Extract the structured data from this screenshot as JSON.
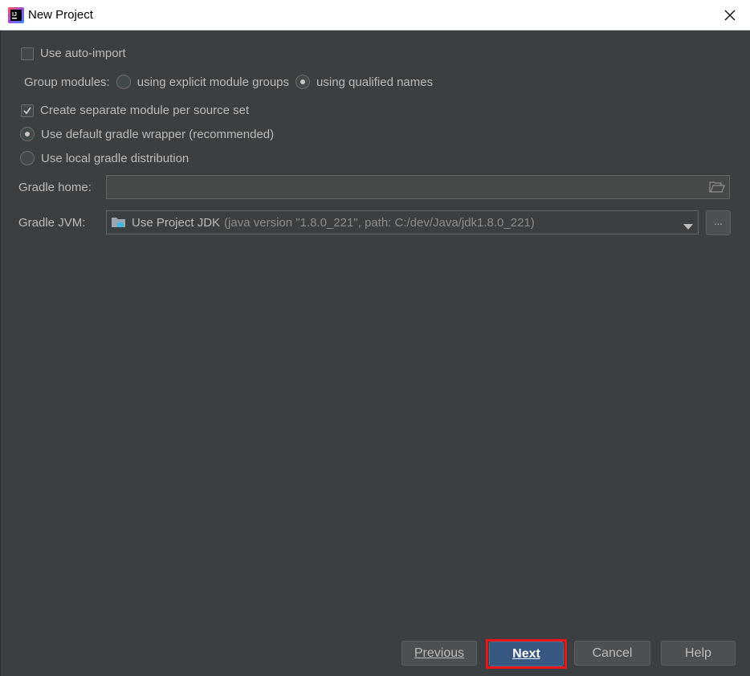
{
  "window": {
    "title": "New Project",
    "app_icon": "intellij-idea-icon",
    "close_icon": "close-icon"
  },
  "options": {
    "auto_import": {
      "label": "Use auto-import",
      "checked": false
    },
    "group_modules": {
      "label": "Group modules:",
      "explicit": {
        "label": "using explicit module groups",
        "selected": false
      },
      "qualified": {
        "label": "using qualified names",
        "selected": true
      }
    },
    "separate_module": {
      "label": "Create separate module per source set",
      "checked": true
    },
    "default_wrapper": {
      "label": "Use default gradle wrapper (recommended)",
      "selected": true
    },
    "local_distribution": {
      "label": "Use local gradle distribution",
      "selected": false
    }
  },
  "gradle_home": {
    "label": "Gradle home:",
    "value": "",
    "icon": "folder-icon"
  },
  "gradle_jvm": {
    "label": "Gradle JVM:",
    "selected_main": "Use Project JDK",
    "selected_detail": "(java version \"1.8.0_221\", path: C:/dev/Java/jdk1.8.0_221)",
    "icon": "jdk-folder-icon",
    "browse_label": "..."
  },
  "footer": {
    "previous": "Previous",
    "next": "Next",
    "cancel": "Cancel",
    "help": "Help",
    "highlight_color": "#e8151a",
    "primary_color": "#365880"
  },
  "colors": {
    "background": "#3c3f41",
    "text": "#bbbbbb"
  }
}
